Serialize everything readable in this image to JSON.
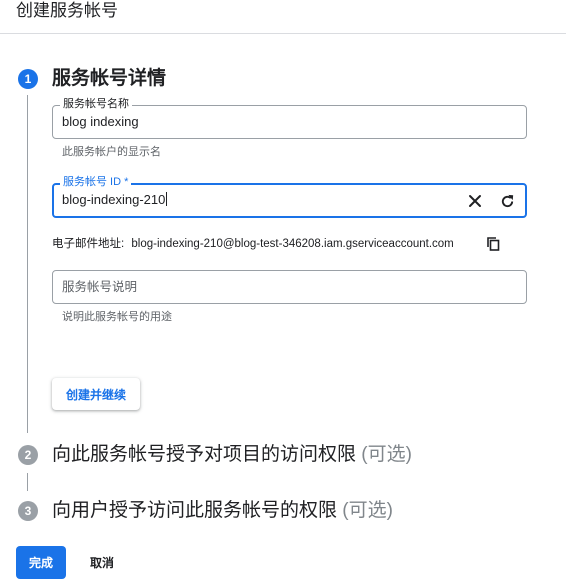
{
  "header": {
    "title": "创建服务帐号"
  },
  "steps": [
    {
      "number": "1",
      "title": "服务帐号详情",
      "optional": ""
    },
    {
      "number": "2",
      "title": "向此服务帐号授予对项目的访问权限",
      "optional": "(可选)"
    },
    {
      "number": "3",
      "title": "向用户授予访问此服务帐号的权限",
      "optional": "(可选)"
    }
  ],
  "form": {
    "name": {
      "label": "服务帐号名称",
      "value": "blog indexing",
      "helper": "此服务帐户的显示名"
    },
    "id": {
      "label": "服务帐号 ID *",
      "value": "blog-indexing-210",
      "clear_icon": "close-icon",
      "refresh_icon": "refresh-icon"
    },
    "email": {
      "label": "电子邮件地址:",
      "value": "blog-indexing-210@blog-test-346208.iam.gserviceaccount.com",
      "copy_icon": "copy-icon"
    },
    "description": {
      "placeholder": "服务帐号说明",
      "helper": "说明此服务帐号的用途"
    },
    "continue_label": "创建并继续"
  },
  "footer": {
    "done_label": "完成",
    "cancel_label": "取消"
  },
  "colors": {
    "accent": "#1a73e8",
    "inactive": "#9aa0a6",
    "text": "#202124",
    "muted": "#5f6368"
  }
}
